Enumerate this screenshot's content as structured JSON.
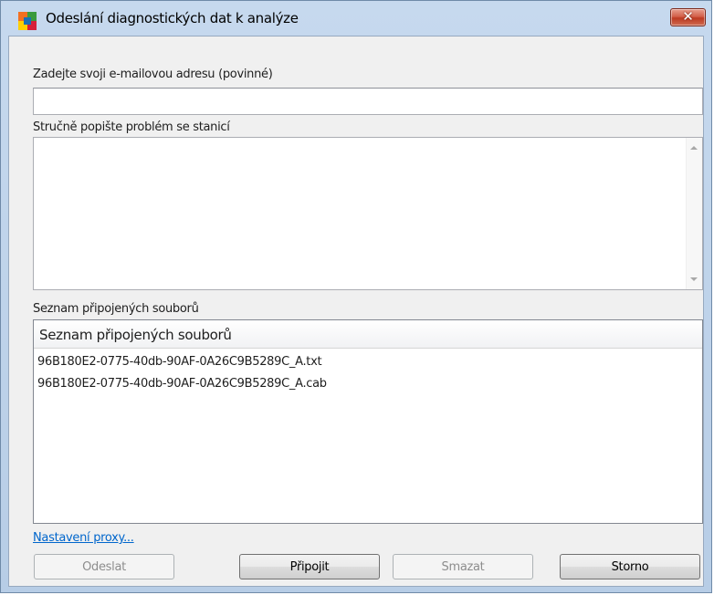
{
  "window": {
    "title": "Odeslání diagnostických dat k analýze",
    "close_symbol": "✕"
  },
  "form": {
    "email_label": "Zadejte svoji e-mailovou adresu (povinné)",
    "email_value": "",
    "description_label": "Stručně popište problém se stanicí",
    "description_value": "",
    "attached_label": "Seznam připojených souborů"
  },
  "files": {
    "column_header": "Seznam připojených souborů",
    "rows": [
      "96B180E2-0775-40db-90AF-0A26C9B5289C_A.txt",
      "96B180E2-0775-40db-90AF-0A26C9B5289C_A.cab"
    ]
  },
  "proxy_link": "Nastavení proxy...",
  "buttons": {
    "send": "Odeslat",
    "attach": "Připojit",
    "delete": "Smazat",
    "cancel": "Storno"
  },
  "icons": {
    "app": "avg-logo-icon",
    "close": "close-icon",
    "scroll_up": "scroll-up-arrow-icon",
    "scroll_down": "scroll-down-arrow-icon"
  },
  "colors": {
    "link": "#0066cc",
    "close_button": "#c4452c",
    "titlebar": "#c6d9ee"
  }
}
